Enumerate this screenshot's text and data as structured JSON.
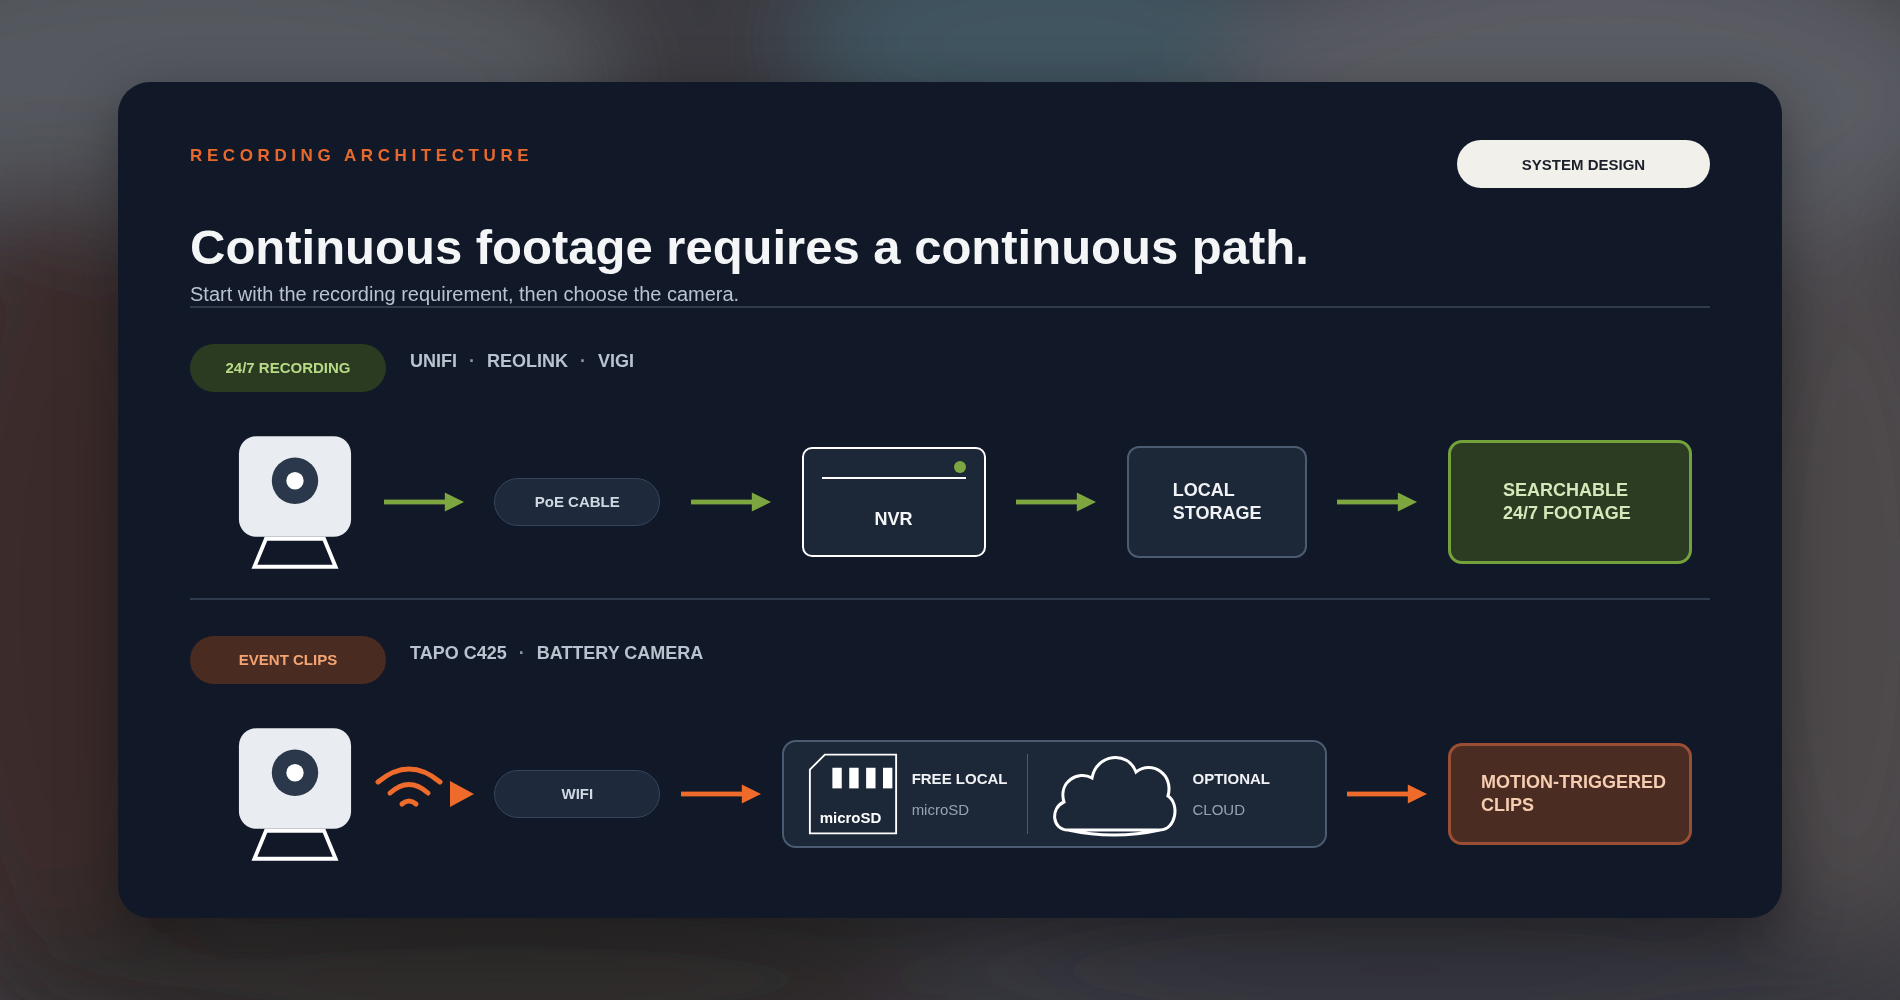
{
  "eyebrow": "RECORDING ARCHITECTURE",
  "badge": "SYSTEM DESIGN",
  "title": "Continuous footage requires a continuous path.",
  "subtitle": "Start with the recording requirement, then choose the camera.",
  "paths": [
    {
      "kind": "continuous",
      "tag": "24/7 RECORDING",
      "brands": [
        "UNIFI",
        "REOLINK",
        "VIGI"
      ],
      "separators": [
        "·",
        "·"
      ],
      "steps": [
        {
          "kind": "camera"
        },
        {
          "kind": "arrow"
        },
        {
          "kind": "link",
          "label": "PoE CABLE"
        },
        {
          "kind": "arrow"
        },
        {
          "kind": "nvr",
          "label": "NVR"
        },
        {
          "kind": "arrow"
        },
        {
          "kind": "box",
          "lines": [
            "LOCAL",
            "STORAGE"
          ]
        },
        {
          "kind": "arrow"
        },
        {
          "kind": "result",
          "lines": [
            "SEARCHABLE",
            "24/7 FOOTAGE"
          ]
        }
      ]
    },
    {
      "kind": "event",
      "tag": "EVENT CLIPS",
      "brands": [
        "TAPO C425",
        "BATTERY CAMERA"
      ],
      "separators": [
        "·"
      ],
      "steps": [
        {
          "kind": "camera"
        },
        {
          "kind": "wireless"
        },
        {
          "kind": "link",
          "label": "WIFI"
        },
        {
          "kind": "arrow"
        },
        {
          "kind": "media",
          "items": [
            {
              "kind": "sd",
              "card_label": "microSD",
              "title": "FREE LOCAL",
              "subtitle": "microSD"
            },
            {
              "kind": "cloud",
              "title": "OPTIONAL",
              "subtitle": "CLOUD"
            }
          ]
        },
        {
          "kind": "arrow"
        },
        {
          "kind": "result",
          "lines": [
            "MOTION-TRIGGERED",
            "CLIPS"
          ]
        }
      ]
    }
  ]
}
